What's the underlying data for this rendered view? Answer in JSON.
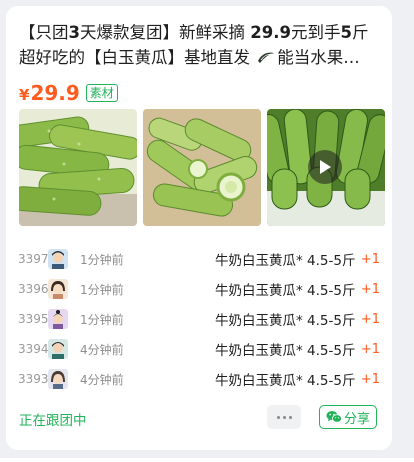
{
  "post": {
    "title_prefix": "【只团",
    "title_bold1": "3",
    "title_mid1": "天爆款复团】新鲜采摘 ",
    "title_bold2": "29.9",
    "title_mid2": "元到手",
    "title_bold3": "5",
    "title_rest": "斤超好吃的【白玉黄瓜】基地直发 ",
    "title_tail": "能当水果…",
    "currency": "¥",
    "price": "29.9",
    "tag": "素材"
  },
  "thumbnails": [
    {
      "icon": "cucumber-photo"
    },
    {
      "icon": "cucumber-basket-photo"
    },
    {
      "icon": "cucumber-video-photo",
      "video": true
    }
  ],
  "orders": [
    {
      "num": "3397",
      "time": "1分钟前",
      "product": "牛奶白玉黄瓜* 4.5-5斤",
      "qty": "+1"
    },
    {
      "num": "3396",
      "time": "1分钟前",
      "product": "牛奶白玉黄瓜* 4.5-5斤",
      "qty": "+1"
    },
    {
      "num": "3395",
      "time": "1分钟前",
      "product": "牛奶白玉黄瓜* 4.5-5斤",
      "qty": "+1"
    },
    {
      "num": "3394",
      "time": "4分钟前",
      "product": "牛奶白玉黄瓜* 4.5-5斤",
      "qty": "+1"
    },
    {
      "num": "3393",
      "time": "4分钟前",
      "product": "牛奶白玉黄瓜* 4.5-5斤",
      "qty": "+1"
    }
  ],
  "footer": {
    "status": "正在跟团中",
    "share_label": "分享"
  },
  "colors": {
    "accent_green": "#21b35a",
    "price_orange": "#ff5a1f",
    "background": "#eef0f3"
  }
}
